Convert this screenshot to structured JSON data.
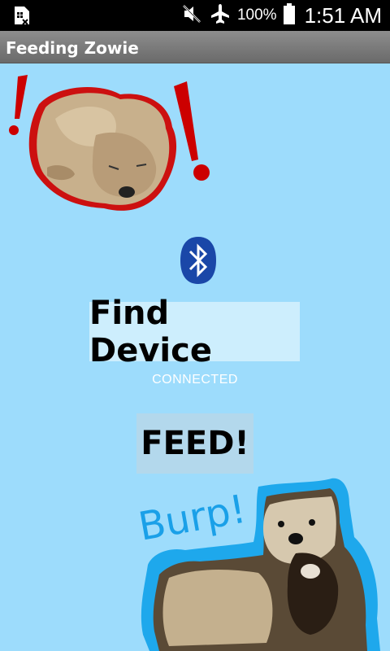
{
  "status_bar": {
    "battery_percent": "100%",
    "time": "1:51 AM",
    "icons": [
      "sim-card-icon",
      "mute-icon",
      "airplane-mode-icon",
      "battery-icon"
    ]
  },
  "app_bar": {
    "title": "Feeding Zowie"
  },
  "top_image": {
    "alt": "dog-alert-image"
  },
  "bluetooth": {
    "icon": "bluetooth-icon",
    "color": "#1a47a8"
  },
  "find_device": {
    "label": "Find Device"
  },
  "connection": {
    "status": "CONNECTED"
  },
  "feed": {
    "label": "FEED!"
  },
  "bottom_image": {
    "caption": "Burp!"
  },
  "colors": {
    "background": "#9ddcfc",
    "alert_red": "#cc0000",
    "burp_blue": "#1aa0e8"
  }
}
